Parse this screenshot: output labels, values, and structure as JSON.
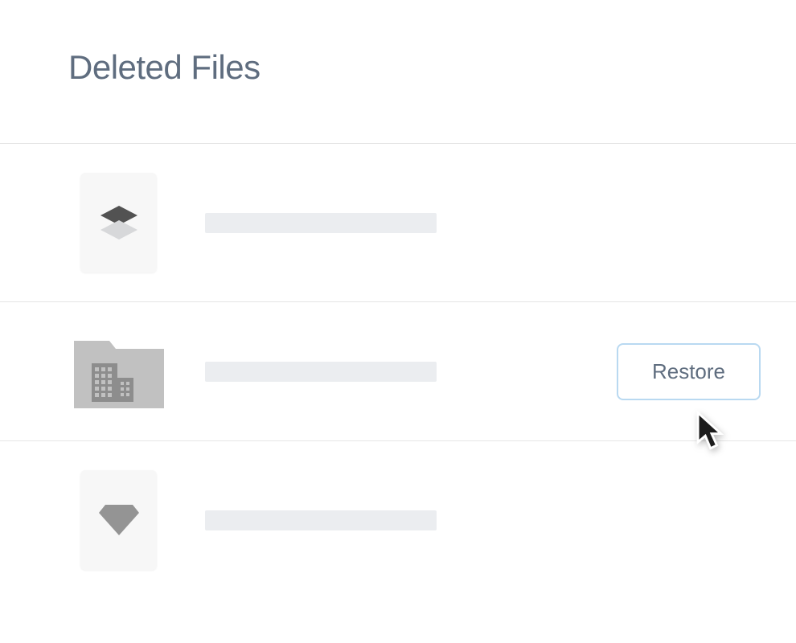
{
  "page": {
    "title": "Deleted Files"
  },
  "files": [
    {
      "icon": "layers",
      "label": ""
    },
    {
      "icon": "folder-building",
      "label": "",
      "action_label": "Restore"
    },
    {
      "icon": "diamond",
      "label": ""
    }
  ],
  "actions": {
    "restore": "Restore"
  }
}
